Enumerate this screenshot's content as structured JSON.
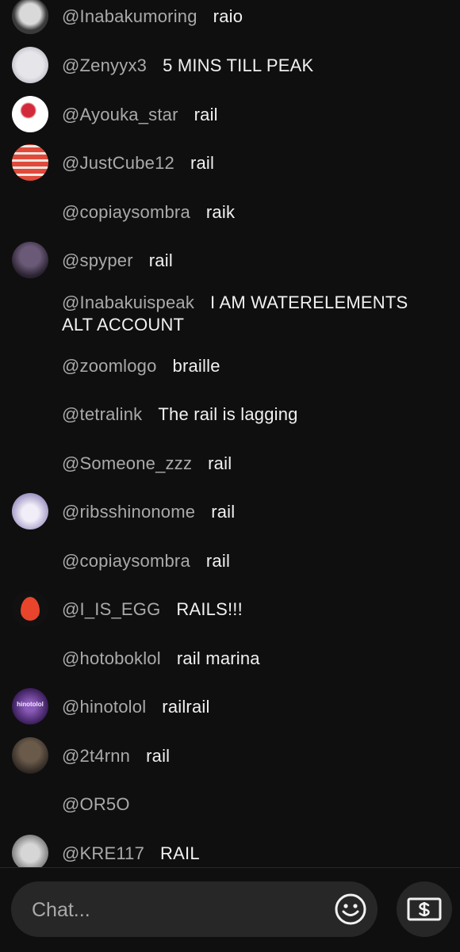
{
  "messages": [
    {
      "author": "@Inabakumoring",
      "text": "raio",
      "avatar": {
        "colors": [
          "#d9d9d9",
          "#3a3a3a"
        ]
      }
    },
    {
      "author": "@Zenyyx3",
      "text": "5 MINS TILL PEAK",
      "avatar": {
        "colors": [
          "#e6e6ea",
          "#b8b8c2"
        ]
      }
    },
    {
      "author": "@Ayouka_star",
      "text": "rail",
      "avatar": {
        "colors": [
          "#ffffff",
          "#d22a3a"
        ]
      }
    },
    {
      "author": "@JustCube12",
      "text": "rail",
      "avatar": {
        "colors": [
          "#e04a3a",
          "#f0e6e0"
        ]
      }
    },
    {
      "author": "@copiaysombra",
      "text": "raik",
      "avatar": null
    },
    {
      "author": "@spyper",
      "text": "rail",
      "avatar": {
        "colors": [
          "#6a5a78",
          "#2a2230"
        ]
      }
    },
    {
      "author": "@Inabakuispeak",
      "text": "I AM WATERELEMENTS ALT ACCOUNT",
      "avatar": null
    },
    {
      "author": "@zoomlogo",
      "text": "braille",
      "avatar": null
    },
    {
      "author": "@tetralink",
      "text": "The rail is lagging",
      "avatar": null
    },
    {
      "author": "@Someone_zzz",
      "text": "rail",
      "avatar": null
    },
    {
      "author": "@ribsshinonome",
      "text": "rail",
      "avatar": {
        "colors": [
          "#e8e4f0",
          "#9a8fc0"
        ]
      }
    },
    {
      "author": "@copiaysombra",
      "text": "rail",
      "avatar": null
    },
    {
      "author": "@I_IS_EGG",
      "text": "RAILS!!!",
      "avatar": {
        "colors": [
          "#1a1a1a",
          "#e8452c"
        ]
      }
    },
    {
      "author": "@hotoboklol",
      "text": "rail marina",
      "avatar": null
    },
    {
      "author": "@hinotolol",
      "text": "railrail",
      "avatar": {
        "colors": [
          "#3a1e5a",
          "#8a5ab8"
        ],
        "label": "hinotolol"
      }
    },
    {
      "author": "@2t4rnn",
      "text": "rail",
      "avatar": {
        "colors": [
          "#6a5a4a",
          "#2a2420"
        ]
      }
    },
    {
      "author": "@OR5O",
      "text": "",
      "avatar": null
    },
    {
      "author": "@KRE117",
      "text": "RAIL",
      "avatar": {
        "colors": [
          "#d6d6d6",
          "#6a6a6a"
        ]
      }
    }
  ],
  "chat_input": {
    "placeholder": "Chat..."
  },
  "icons": {
    "emoji": "smiley-icon",
    "super_chat": "dollar-bill-icon"
  }
}
